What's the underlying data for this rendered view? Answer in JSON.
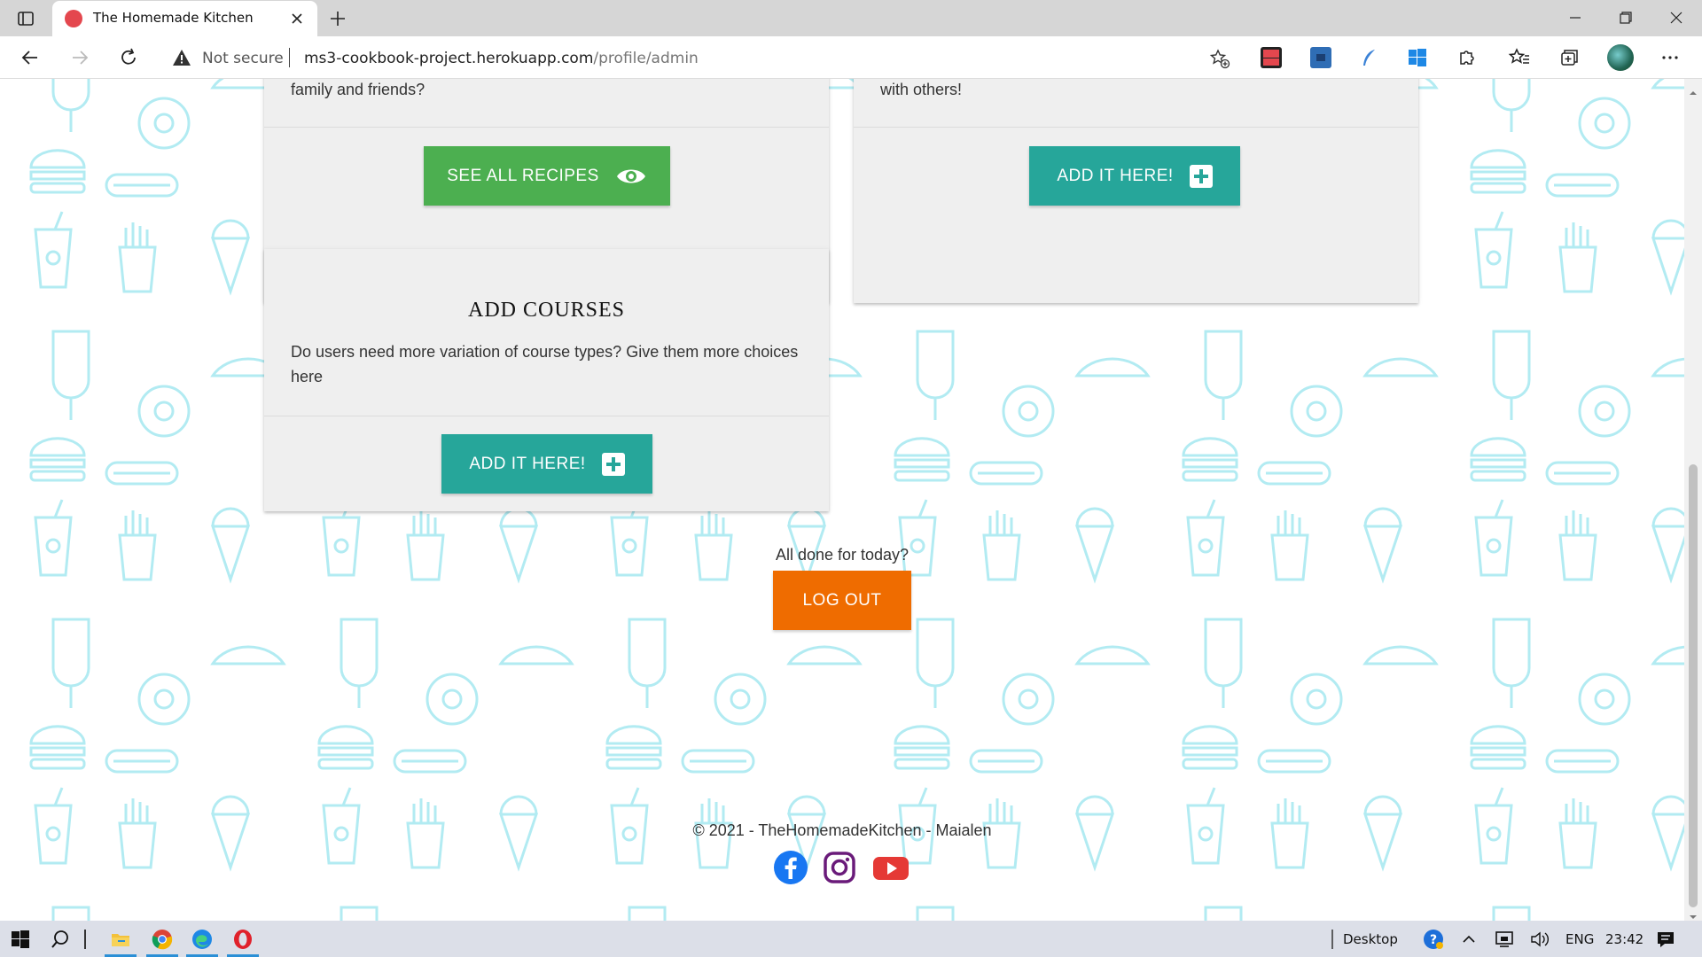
{
  "browser": {
    "tab_title": "The Homemade Kitchen",
    "security_label": "Not secure",
    "url_host": "ms3-cookbook-project.herokuapp.com",
    "url_path": "/profile/admin"
  },
  "page": {
    "card_recipes": {
      "text": "family and friends?",
      "button_label": "SEE ALL RECIPES"
    },
    "card_add_recipe": {
      "text": "with others!",
      "button_label": "ADD IT HERE!"
    },
    "card_courses": {
      "title": "ADD COURSES",
      "text": "Do users need more variation of course types? Give them more choices here",
      "button_label": "ADD IT HERE!"
    },
    "logout": {
      "prompt": "All done for today?",
      "button_label": "LOG OUT"
    },
    "footer": {
      "copyright": "© 2021 - TheHomemadeKitchen - Maialen"
    }
  },
  "colors": {
    "green": "#4caf50",
    "teal": "#26a69a",
    "orange": "#ef6c00",
    "pattern": "#b2ebf2"
  },
  "taskbar": {
    "desktop_label": "Desktop",
    "language": "ENG",
    "time": "23:42"
  }
}
